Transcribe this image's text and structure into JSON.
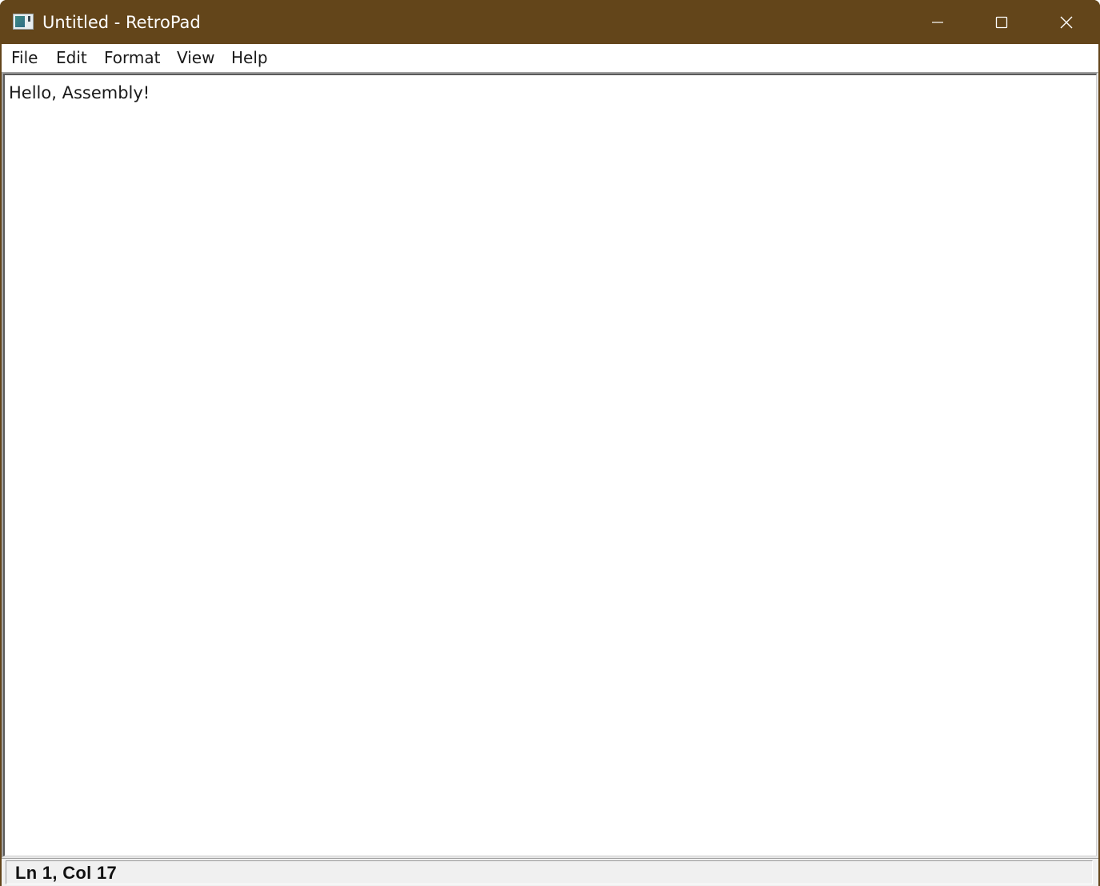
{
  "window": {
    "title": "Untitled - RetroPad",
    "app_icon": "retropad-app-icon",
    "title_bar_color": "#63451a"
  },
  "caption_buttons": {
    "minimize_icon": "minimize-icon",
    "maximize_icon": "maximize-icon",
    "close_icon": "close-icon"
  },
  "menu": {
    "items": [
      {
        "label": "File"
      },
      {
        "label": "Edit"
      },
      {
        "label": "Format"
      },
      {
        "label": "View"
      },
      {
        "label": "Help"
      }
    ]
  },
  "editor": {
    "content": "Hello, Assembly!"
  },
  "status": {
    "position": "Ln 1, Col 17"
  }
}
